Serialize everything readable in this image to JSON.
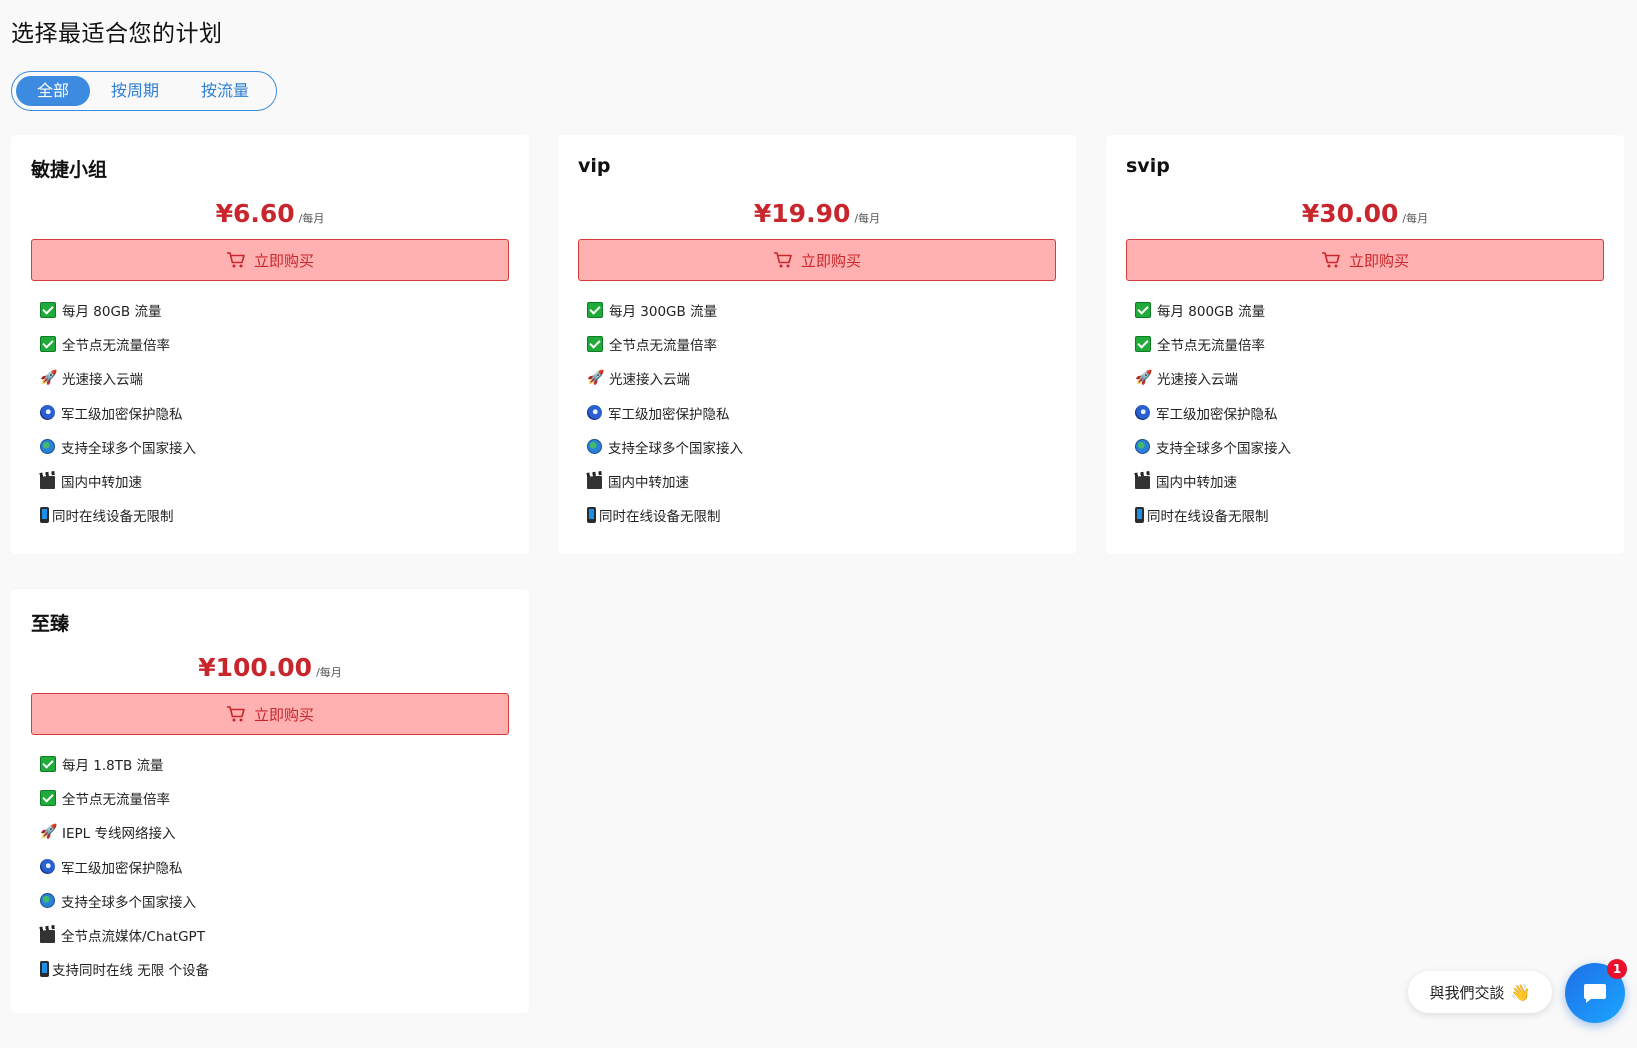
{
  "page": {
    "title": "选择最适合您的计划"
  },
  "filter": {
    "tabs": [
      {
        "label": "全部",
        "active": true
      },
      {
        "label": "按周期",
        "active": false
      },
      {
        "label": "按流量",
        "active": false
      }
    ]
  },
  "buy_label": "立即购买",
  "plans": [
    {
      "name": "敏捷小组",
      "price": "¥6.60",
      "period": "/每月",
      "features": [
        {
          "icon": "check-icon",
          "text": "每月 80GB 流量"
        },
        {
          "icon": "check-icon",
          "text": "全节点无流量倍率"
        },
        {
          "icon": "rocket-icon",
          "text": "光速接入云端"
        },
        {
          "icon": "lock-icon",
          "text": "军工级加密保护隐私"
        },
        {
          "icon": "globe-icon",
          "text": "支持全球多个国家接入"
        },
        {
          "icon": "clapper-icon",
          "text": "国内中转加速"
        },
        {
          "icon": "phone-icon",
          "text": "同时在线设备无限制"
        }
      ]
    },
    {
      "name": "vip",
      "price": "¥19.90",
      "period": "/每月",
      "features": [
        {
          "icon": "check-icon",
          "text": "每月 300GB 流量"
        },
        {
          "icon": "check-icon",
          "text": "全节点无流量倍率"
        },
        {
          "icon": "rocket-icon",
          "text": "光速接入云端"
        },
        {
          "icon": "lock-icon",
          "text": "军工级加密保护隐私"
        },
        {
          "icon": "globe-icon",
          "text": "支持全球多个国家接入"
        },
        {
          "icon": "clapper-icon",
          "text": "国内中转加速"
        },
        {
          "icon": "phone-icon",
          "text": "同时在线设备无限制"
        }
      ]
    },
    {
      "name": "svip",
      "price": "¥30.00",
      "period": "/每月",
      "features": [
        {
          "icon": "check-icon",
          "text": "每月 800GB 流量"
        },
        {
          "icon": "check-icon",
          "text": "全节点无流量倍率"
        },
        {
          "icon": "rocket-icon",
          "text": "光速接入云端"
        },
        {
          "icon": "lock-icon",
          "text": "军工级加密保护隐私"
        },
        {
          "icon": "globe-icon",
          "text": "支持全球多个国家接入"
        },
        {
          "icon": "clapper-icon",
          "text": "国内中转加速"
        },
        {
          "icon": "phone-icon",
          "text": "同时在线设备无限制"
        }
      ]
    },
    {
      "name": "至臻",
      "price": "¥100.00",
      "period": "/每月",
      "features": [
        {
          "icon": "check-icon",
          "text": "每月 1.8TB 流量"
        },
        {
          "icon": "check-icon",
          "text": "全节点无流量倍率"
        },
        {
          "icon": "rocket-icon",
          "text": "IEPL 专线网络接入"
        },
        {
          "icon": "lock-icon",
          "text": "军工级加密保护隐私"
        },
        {
          "icon": "globe-icon",
          "text": "支持全球多个国家接入"
        },
        {
          "icon": "clapper-icon",
          "text": "全节点流媒体/ChatGPT"
        },
        {
          "icon": "phone-icon",
          "text": "支持同时在线 无限 个设备"
        }
      ]
    }
  ],
  "chat": {
    "label": "與我們交談",
    "wave_emoji": "👋",
    "badge_count": "1",
    "accent": "#1f6fe6"
  },
  "colors": {
    "price": "#c8262c",
    "buy_bg": "#ffb0b0",
    "tab_accent": "#3d8be0"
  }
}
